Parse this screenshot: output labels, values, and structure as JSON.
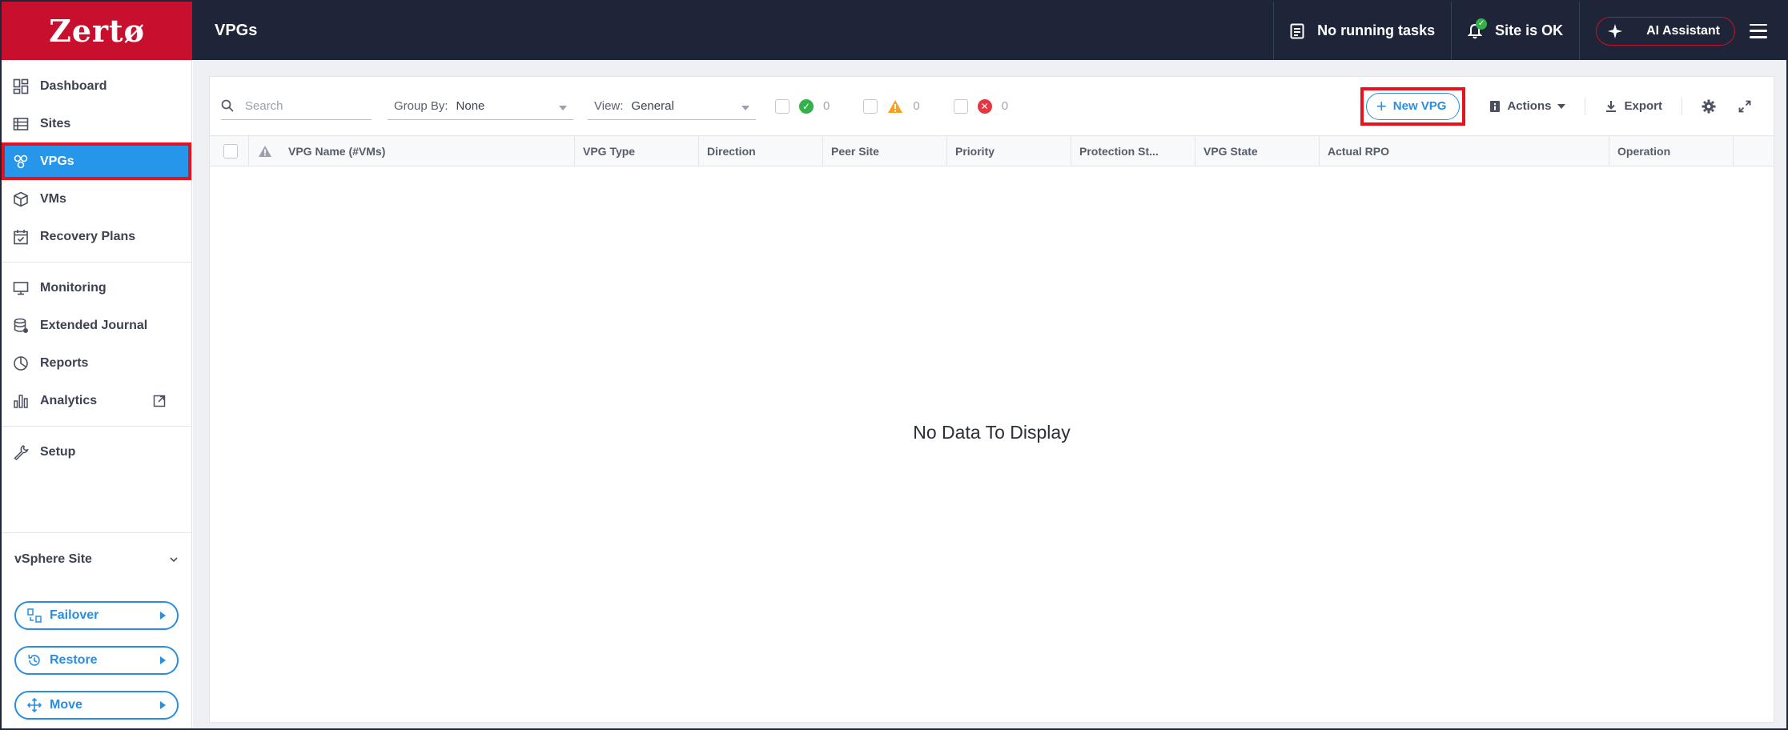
{
  "app": {
    "logo": "Zertø",
    "page_title": "VPGs"
  },
  "topbar": {
    "tasks_label": "No running tasks",
    "site_status": "Site is OK",
    "ai_label": "AI Assistant"
  },
  "sidebar": {
    "items": [
      {
        "label": "Dashboard",
        "icon": "dashboard-icon"
      },
      {
        "label": "Sites",
        "icon": "sites-icon"
      },
      {
        "label": "VPGs",
        "icon": "vpgs-icon",
        "active": true
      },
      {
        "label": "VMs",
        "icon": "cube-icon"
      },
      {
        "label": "Recovery Plans",
        "icon": "calendar-check-icon"
      },
      {
        "label": "Monitoring",
        "icon": "monitor-icon"
      },
      {
        "label": "Extended Journal",
        "icon": "database-icon"
      },
      {
        "label": "Reports",
        "icon": "pie-chart-icon"
      },
      {
        "label": "Analytics",
        "icon": "bar-chart-icon"
      },
      {
        "label": "Setup",
        "icon": "wrench-icon"
      }
    ],
    "site_select": "vSphere Site",
    "actions": [
      {
        "label": "Failover",
        "icon": "failover-icon"
      },
      {
        "label": "Restore",
        "icon": "restore-icon"
      },
      {
        "label": "Move",
        "icon": "move-icon"
      }
    ]
  },
  "toolbar": {
    "search_placeholder": "Search",
    "group_by_label": "Group By:",
    "group_by_value": "None",
    "view_label": "View:",
    "view_value": "General",
    "status_ok_count": "0",
    "status_warn_count": "0",
    "status_err_count": "0",
    "new_vpg": "New VPG",
    "actions": "Actions",
    "export": "Export"
  },
  "table": {
    "columns": [
      "VPG Name (#VMs)",
      "VPG Type",
      "Direction",
      "Peer Site",
      "Priority",
      "Protection St...",
      "VPG State",
      "Actual RPO",
      "Operation"
    ],
    "empty_message": "No Data To Display"
  },
  "colors": {
    "brand_red": "#c8102e",
    "topbar_bg": "#1e2539",
    "active_blue": "#2596ea",
    "link_blue": "#2a8de0",
    "ok_green": "#33b24a",
    "warn_orange": "#f4a320",
    "err_red": "#e5363f",
    "highlight_red": "#e8121c"
  }
}
